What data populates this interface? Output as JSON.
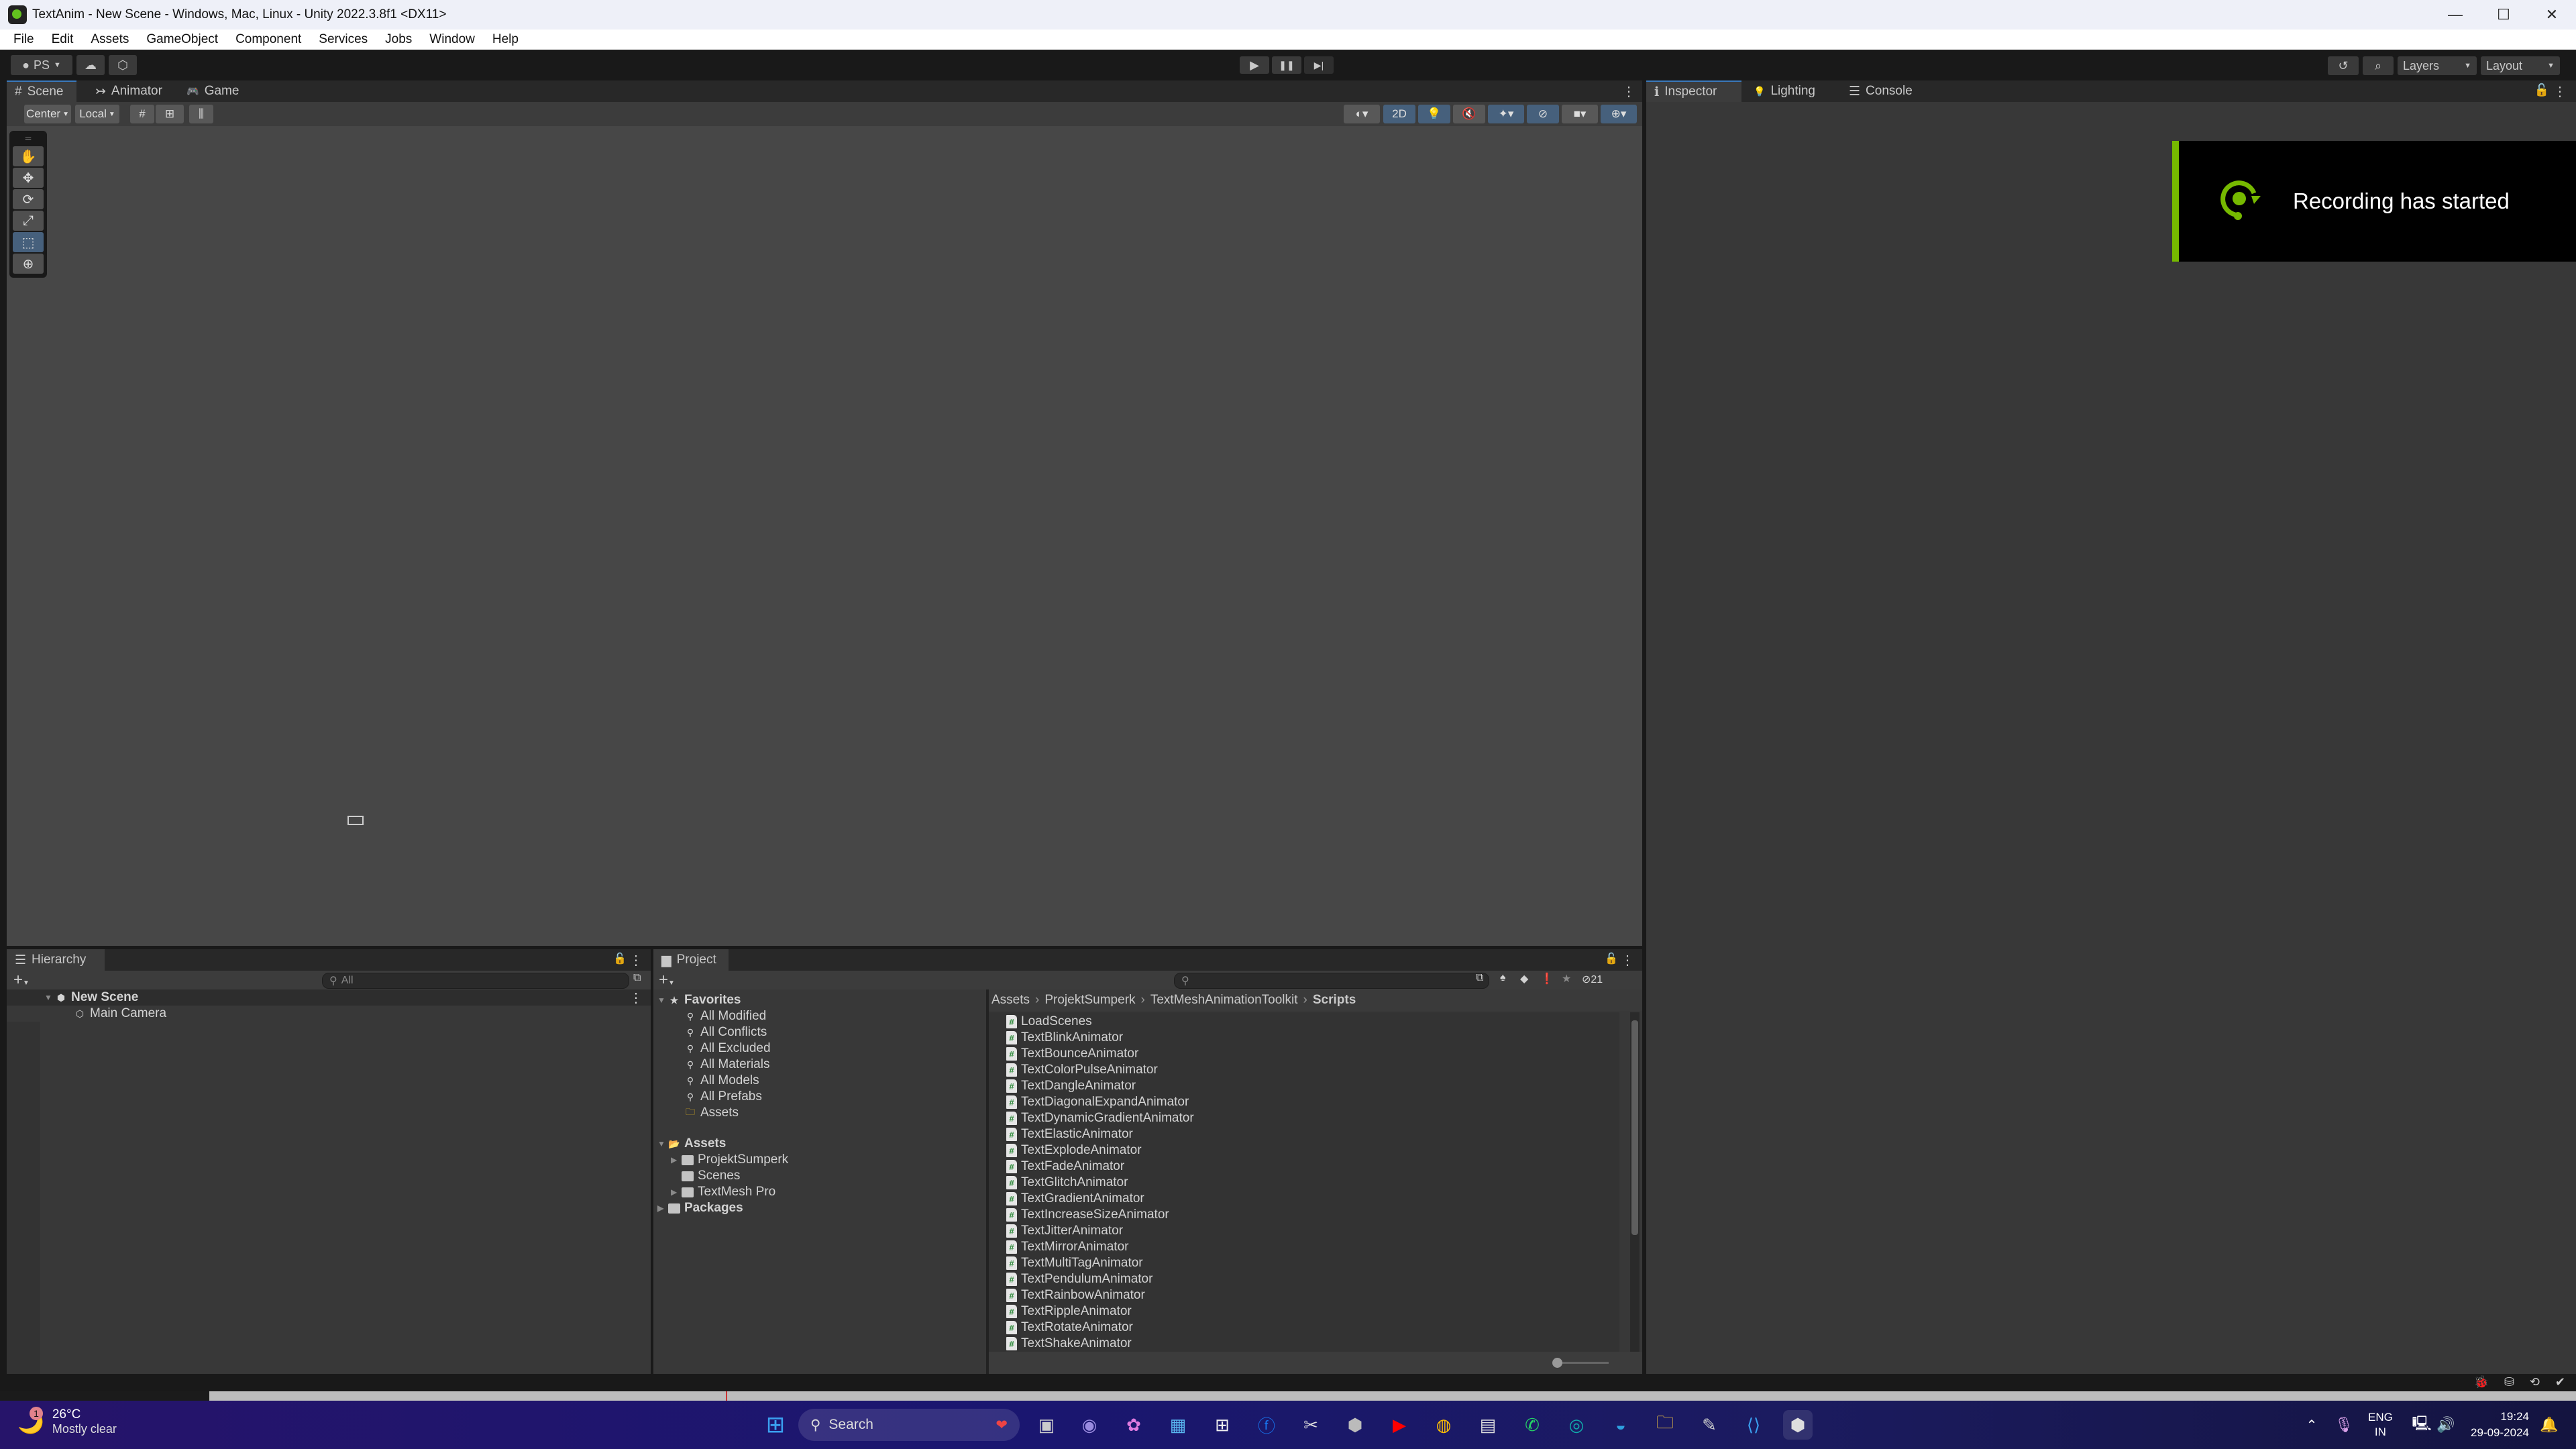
{
  "window": {
    "title": "TextAnim - New Scene - Windows, Mac, Linux - Unity 2022.3.8f1 <DX11>",
    "controls": {
      "minimize": "—",
      "maximize": "☐",
      "close": "✕"
    }
  },
  "menu": [
    "File",
    "Edit",
    "Assets",
    "GameObject",
    "Component",
    "Services",
    "Jobs",
    "Window",
    "Help"
  ],
  "toolbar": {
    "account_label": "PS",
    "cloud_icon": "cloud-icon",
    "collab_icon": "unity-version-control-icon",
    "play_icon": "▶",
    "pause_icon": "❚❚",
    "step_icon": "▶|",
    "history_icon": "↺",
    "search_icon": "⌕",
    "layers_label": "Layers",
    "layout_label": "Layout"
  },
  "scene_panel": {
    "tabs": [
      {
        "label": "Scene",
        "icon": "#"
      },
      {
        "label": "Animator",
        "icon": "↣"
      },
      {
        "label": "Game",
        "icon": "🎮"
      }
    ],
    "pivot_label": "Center",
    "space_label": "Local",
    "toggle_2d": "2D",
    "tools": [
      "hand",
      "move",
      "rotate",
      "scale",
      "rect",
      "transform"
    ],
    "selected_tool": "rect"
  },
  "inspector_panel": {
    "tabs": [
      {
        "label": "Inspector",
        "icon": "ℹ"
      },
      {
        "label": "Lighting",
        "icon": "💡"
      },
      {
        "label": "Console",
        "icon": "☰"
      }
    ]
  },
  "notification": {
    "text": "Recording has started",
    "accent": "#76b900"
  },
  "hierarchy": {
    "title": "Hierarchy",
    "search_placeholder": "All",
    "scene_name": "New Scene",
    "items": [
      "Main Camera"
    ]
  },
  "project": {
    "title": "Project",
    "hidden_count": "21",
    "favorites_label": "Favorites",
    "favorites": [
      "All Modified",
      "All Conflicts",
      "All Excluded",
      "All Materials",
      "All Models",
      "All Prefabs",
      "Assets"
    ],
    "assets_label": "Assets",
    "asset_folders": [
      "ProjektSumperk",
      "Scenes",
      "TextMesh Pro"
    ],
    "packages_label": "Packages",
    "breadcrumb": [
      "Assets",
      "ProjektSumperk",
      "TextMeshAnimationToolkit",
      "Scripts"
    ],
    "files": [
      "LoadScenes",
      "TextBlinkAnimator",
      "TextBounceAnimator",
      "TextColorPulseAnimator",
      "TextDangleAnimator",
      "TextDiagonalExpandAnimator",
      "TextDynamicGradientAnimator",
      "TextElasticAnimator",
      "TextExplodeAnimator",
      "TextFadeAnimator",
      "TextGlitchAnimator",
      "TextGradientAnimator",
      "TextIncreaseSizeAnimator",
      "TextJitterAnimator",
      "TextMirrorAnimator",
      "TextMultiTagAnimator",
      "TextPendulumAnimator",
      "TextRainbowAnimator",
      "TextRippleAnimator",
      "TextRotateAnimator",
      "TextShakeAnimator"
    ]
  },
  "taskbar": {
    "weather_temp": "26°C",
    "weather_desc": "Mostly clear",
    "weather_badge": "1",
    "search_label": "Search",
    "language": "ENG",
    "region": "IN",
    "time": "19:24",
    "date": "29-09-2024"
  }
}
